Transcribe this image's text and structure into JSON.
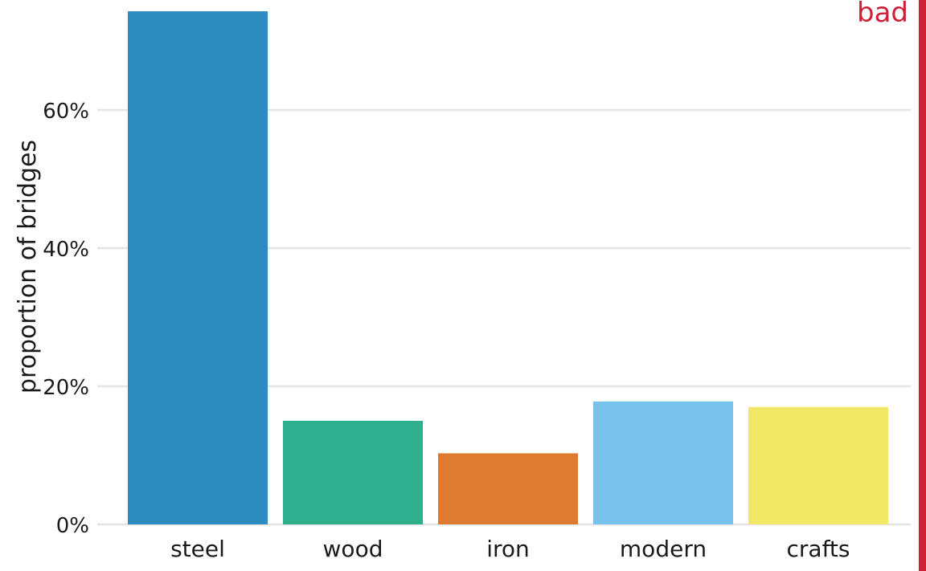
{
  "chart_data": {
    "type": "bar",
    "title": "",
    "xlabel": "",
    "ylabel": "proportion of bridges",
    "categories": [
      "steel",
      "wood",
      "iron",
      "modern",
      "crafts"
    ],
    "values": [
      74.3,
      15.0,
      10.3,
      17.8,
      17.0
    ],
    "colors": [
      "#2e8bc0",
      "#2eb08c",
      "#de7b30",
      "#76c2ec",
      "#f2e866"
    ],
    "ylim": [
      0,
      75
    ],
    "yticks": [
      0,
      20,
      40,
      60
    ],
    "ytick_labels": [
      "0%",
      "20%",
      "40%",
      "60%"
    ],
    "grid": true,
    "legend": "none"
  },
  "annotation": {
    "label": "bad",
    "color": "#d02038"
  }
}
